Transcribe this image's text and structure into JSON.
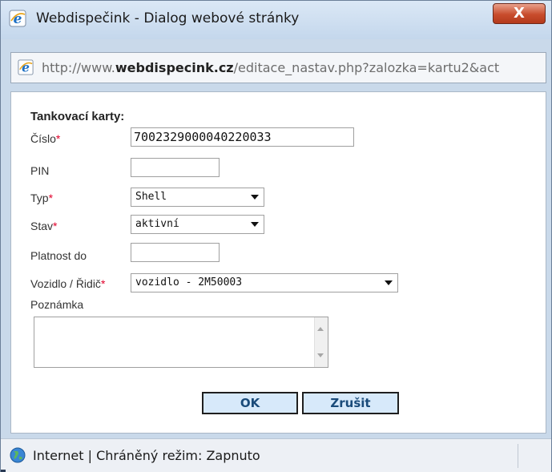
{
  "window": {
    "title": "Webdispečink - Dialog webové stránky",
    "close_label": "X"
  },
  "address": {
    "prefix": "http://www.",
    "domain": "webdispecink.cz",
    "path": "/editace_nastav.php?zalozka=kartu2&act"
  },
  "form": {
    "section_title": "Tankovací karty:",
    "required_marker": "*",
    "fields": {
      "cislo": {
        "label": "Číslo",
        "value": "7002329000040220033"
      },
      "pin": {
        "label": "PIN",
        "value": ""
      },
      "typ": {
        "label": "Typ",
        "value": "Shell"
      },
      "stav": {
        "label": "Stav",
        "value": "aktivní"
      },
      "platnost": {
        "label": "Platnost do",
        "value": ""
      },
      "vozidlo": {
        "label": "Vozidlo / Řidič",
        "value": "vozidlo - 2M50003"
      },
      "poznamka": {
        "label": "Poznámka",
        "value": ""
      }
    },
    "ok_label": "OK",
    "cancel_label": "Zrušit"
  },
  "status": {
    "text": "Internet | Chráněný režim: Zapnuto"
  },
  "icons": {
    "ie": "ie-icon",
    "globe": "globe-icon",
    "close": "close-icon"
  },
  "colors": {
    "required": "#e0002a",
    "button_fill": "#d7e9fa",
    "close_button": "#c84c2c"
  }
}
